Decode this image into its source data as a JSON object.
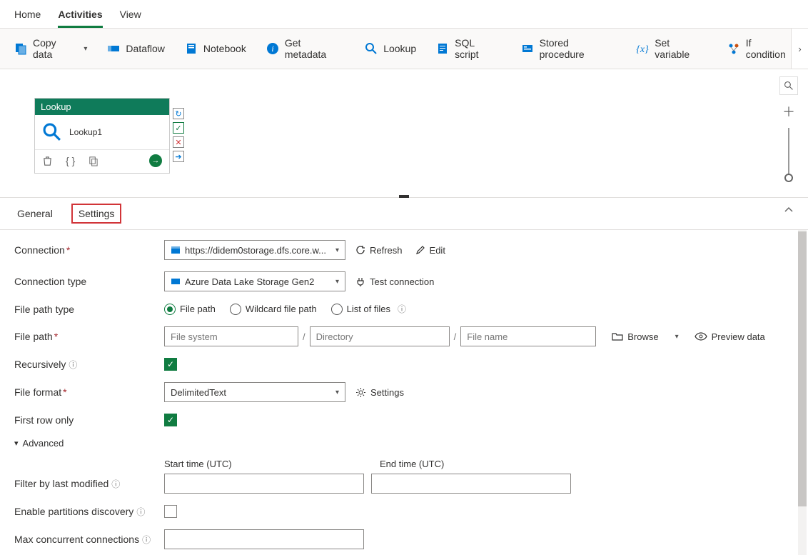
{
  "topTabs": {
    "home": "Home",
    "activities": "Activities",
    "view": "View"
  },
  "ribbon": {
    "copyData": "Copy data",
    "dataflow": "Dataflow",
    "notebook": "Notebook",
    "getMetadata": "Get metadata",
    "lookup": "Lookup",
    "sqlScript": "SQL script",
    "storedProcedure": "Stored procedure",
    "setVariable": "Set variable",
    "ifCondition": "If condition"
  },
  "node": {
    "type": "Lookup",
    "name": "Lookup1"
  },
  "detailTabs": {
    "general": "General",
    "settings": "Settings"
  },
  "settings": {
    "labels": {
      "connection": "Connection",
      "connectionType": "Connection type",
      "filePathType": "File path type",
      "filePath": "File path",
      "recursively": "Recursively",
      "fileFormat": "File format",
      "firstRowOnly": "First row only",
      "advanced": "Advanced",
      "startTime": "Start time (UTC)",
      "endTime": "End time (UTC)",
      "filterByLastModified": "Filter by last modified",
      "enablePartitionsDiscovery": "Enable partitions discovery",
      "maxConcurrentConnections": "Max concurrent connections"
    },
    "actions": {
      "refresh": "Refresh",
      "edit": "Edit",
      "testConnection": "Test connection",
      "browse": "Browse",
      "previewData": "Preview data",
      "settingsLink": "Settings"
    },
    "connectionValue": "https://didem0storage.dfs.core.w...",
    "connectionTypeValue": "Azure Data Lake Storage Gen2",
    "filePathTypeOptions": {
      "path": "File path",
      "wildcard": "Wildcard file path",
      "list": "List of files"
    },
    "filePathPlaceholders": {
      "fs": "File system",
      "dir": "Directory",
      "name": "File name"
    },
    "fileFormatValue": "DelimitedText"
  }
}
